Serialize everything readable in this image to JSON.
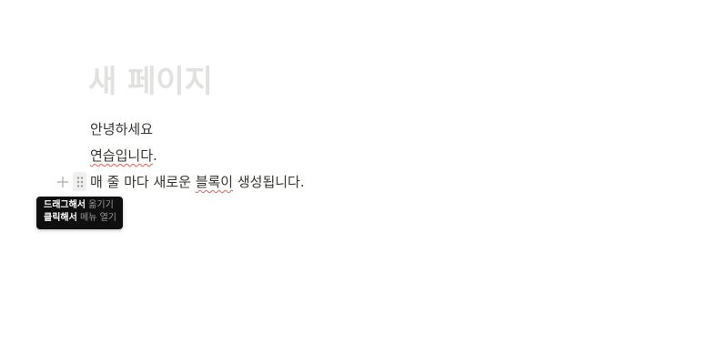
{
  "page": {
    "title": "새 페이지"
  },
  "blocks": [
    {
      "text": "안녕하세요"
    },
    {
      "text_underlined": "연습입니다",
      "text_rest": "."
    },
    {
      "text_a": "매 줄 마다 새로운 ",
      "text_underlined": "블록이",
      "text_b": " 생성됩니다."
    }
  ],
  "handles": {
    "add_icon": "plus-icon",
    "drag_icon": "drag-handle-icon"
  },
  "tooltip": {
    "line1_strong": "드래그해서",
    "line1_weak": " 옮기기",
    "line2_strong": "클릭해서",
    "line2_weak": " 메뉴 열기"
  },
  "colors": {
    "title_placeholder": "#e1e1e0",
    "text": "#37352f",
    "handle": "#b4b4b0",
    "tooltip_bg": "#0f0f0f",
    "spellcheck": "#e16259"
  }
}
